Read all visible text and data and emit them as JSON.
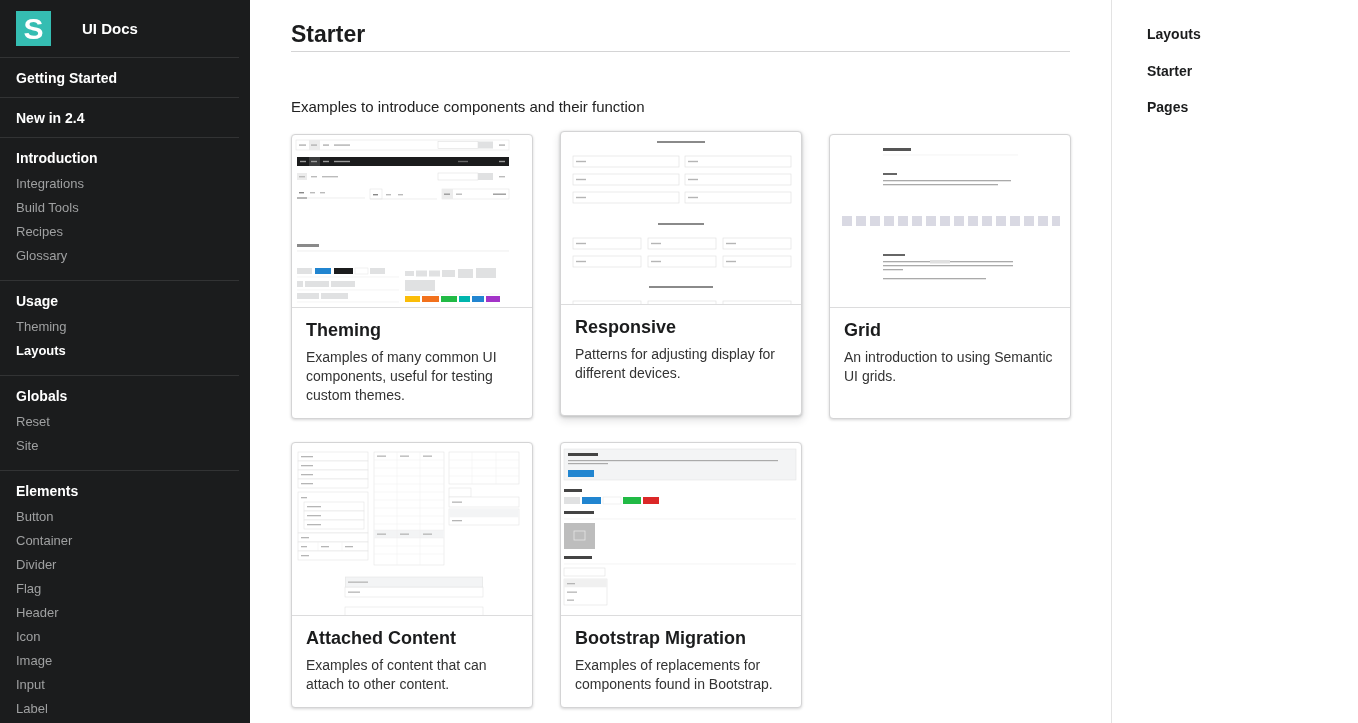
{
  "sidebar": {
    "logo_letter": "S",
    "title": "UI Docs",
    "sections": [
      {
        "title": "Getting Started"
      },
      {
        "title": "New in 2.4"
      },
      {
        "title": "Introduction",
        "items": [
          {
            "label": "Integrations",
            "selected": false
          },
          {
            "label": "Build Tools",
            "selected": false
          },
          {
            "label": "Recipes",
            "selected": false
          },
          {
            "label": "Glossary",
            "selected": false
          }
        ]
      },
      {
        "title": "Usage",
        "items": [
          {
            "label": "Theming",
            "selected": false
          },
          {
            "label": "Layouts",
            "selected": true
          }
        ]
      },
      {
        "title": "Globals",
        "items": [
          {
            "label": "Reset",
            "selected": false
          },
          {
            "label": "Site",
            "selected": false
          }
        ]
      },
      {
        "title": "Elements",
        "items": [
          {
            "label": "Button",
            "selected": false
          },
          {
            "label": "Container",
            "selected": false
          },
          {
            "label": "Divider",
            "selected": false
          },
          {
            "label": "Flag",
            "selected": false
          },
          {
            "label": "Header",
            "selected": false
          },
          {
            "label": "Icon",
            "selected": false
          },
          {
            "label": "Image",
            "selected": false
          },
          {
            "label": "Input",
            "selected": false
          },
          {
            "label": "Label",
            "selected": false
          }
        ]
      }
    ]
  },
  "page": {
    "title": "Starter",
    "intro": "Examples to introduce components and their function",
    "cards": [
      {
        "kind": "theming",
        "title": "Theming",
        "description": "Examples of many common UI components, useful for testing custom themes.",
        "hovered": false
      },
      {
        "kind": "responsive",
        "title": "Responsive",
        "description": "Patterns for adjusting display for different devices.",
        "hovered": true
      },
      {
        "kind": "grid",
        "title": "Grid",
        "description": "An introduction to using Semantic UI grids.",
        "hovered": false
      },
      {
        "kind": "attached",
        "title": "Attached Content",
        "description": "Examples of content that can attach to other content.",
        "hovered": false
      },
      {
        "kind": "bootstrap",
        "title": "Bootstrap Migration",
        "description": "Examples of replacements for components found in Bootstrap.",
        "hovered": false
      }
    ]
  },
  "toc": {
    "items": [
      "Layouts",
      "Starter",
      "Pages"
    ]
  }
}
